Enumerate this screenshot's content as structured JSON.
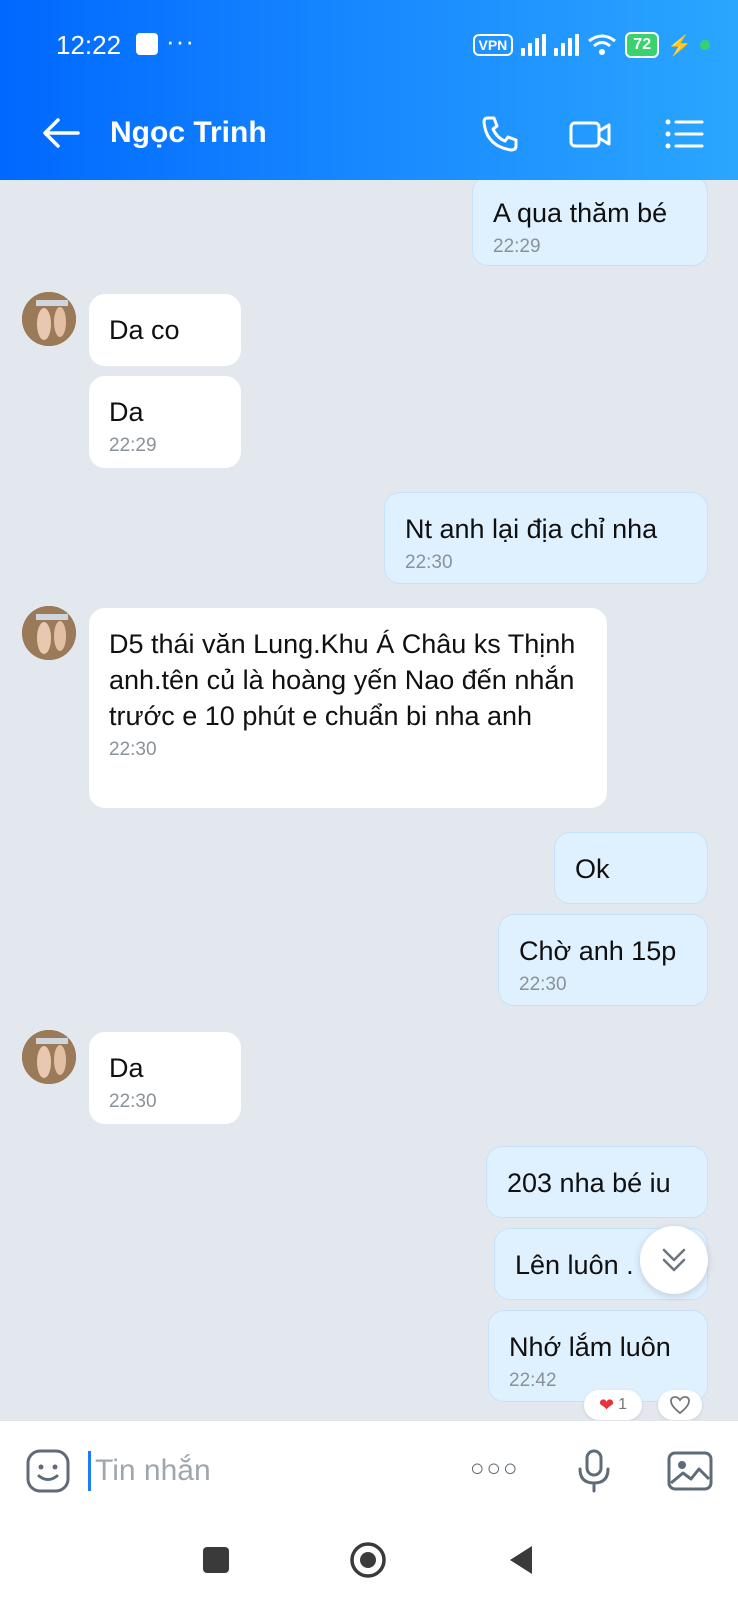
{
  "status_bar": {
    "time": "12:22",
    "more": "···",
    "vpn": "VPN",
    "battery": "72"
  },
  "header": {
    "contact_name": "Ngọc Trinh"
  },
  "messages": [
    {
      "dir": "out",
      "text": "A qua thăm bé",
      "time": "22:29"
    },
    {
      "dir": "in",
      "text": "Da co",
      "time": ""
    },
    {
      "dir": "in",
      "text": "Da",
      "time": "22:29"
    },
    {
      "dir": "out",
      "text": "Nt anh lại địa chỉ nha",
      "time": "22:30"
    },
    {
      "dir": "in",
      "text": "D5 thái văn Lung.Khu Á Châu ks Thịnh anh.tên củ là hoàng yến Nao đến nhắn trước e 10 phút e chuẩn bi nha anh",
      "time": "22:30"
    },
    {
      "dir": "out",
      "text": "Ok",
      "time": ""
    },
    {
      "dir": "out",
      "text": "Chờ anh 15p",
      "time": "22:30"
    },
    {
      "dir": "in",
      "text": "Da",
      "time": "22:30"
    },
    {
      "dir": "out",
      "text": "203 nha bé iu",
      "time": ""
    },
    {
      "dir": "out",
      "text": "Lên luôn .",
      "time": ""
    },
    {
      "dir": "out",
      "text": "Nhớ lắm luôn",
      "time": "22:42"
    }
  ],
  "reaction": {
    "count": "1"
  },
  "composer": {
    "placeholder": "Tin nhắn",
    "more": "○○○"
  },
  "colors": {
    "header_start": "#0068ff",
    "header_end": "#2aa6ff",
    "outgoing_bubble": "#dff0ff",
    "incoming_bubble": "#ffffff",
    "background": "#e3e8ef"
  }
}
